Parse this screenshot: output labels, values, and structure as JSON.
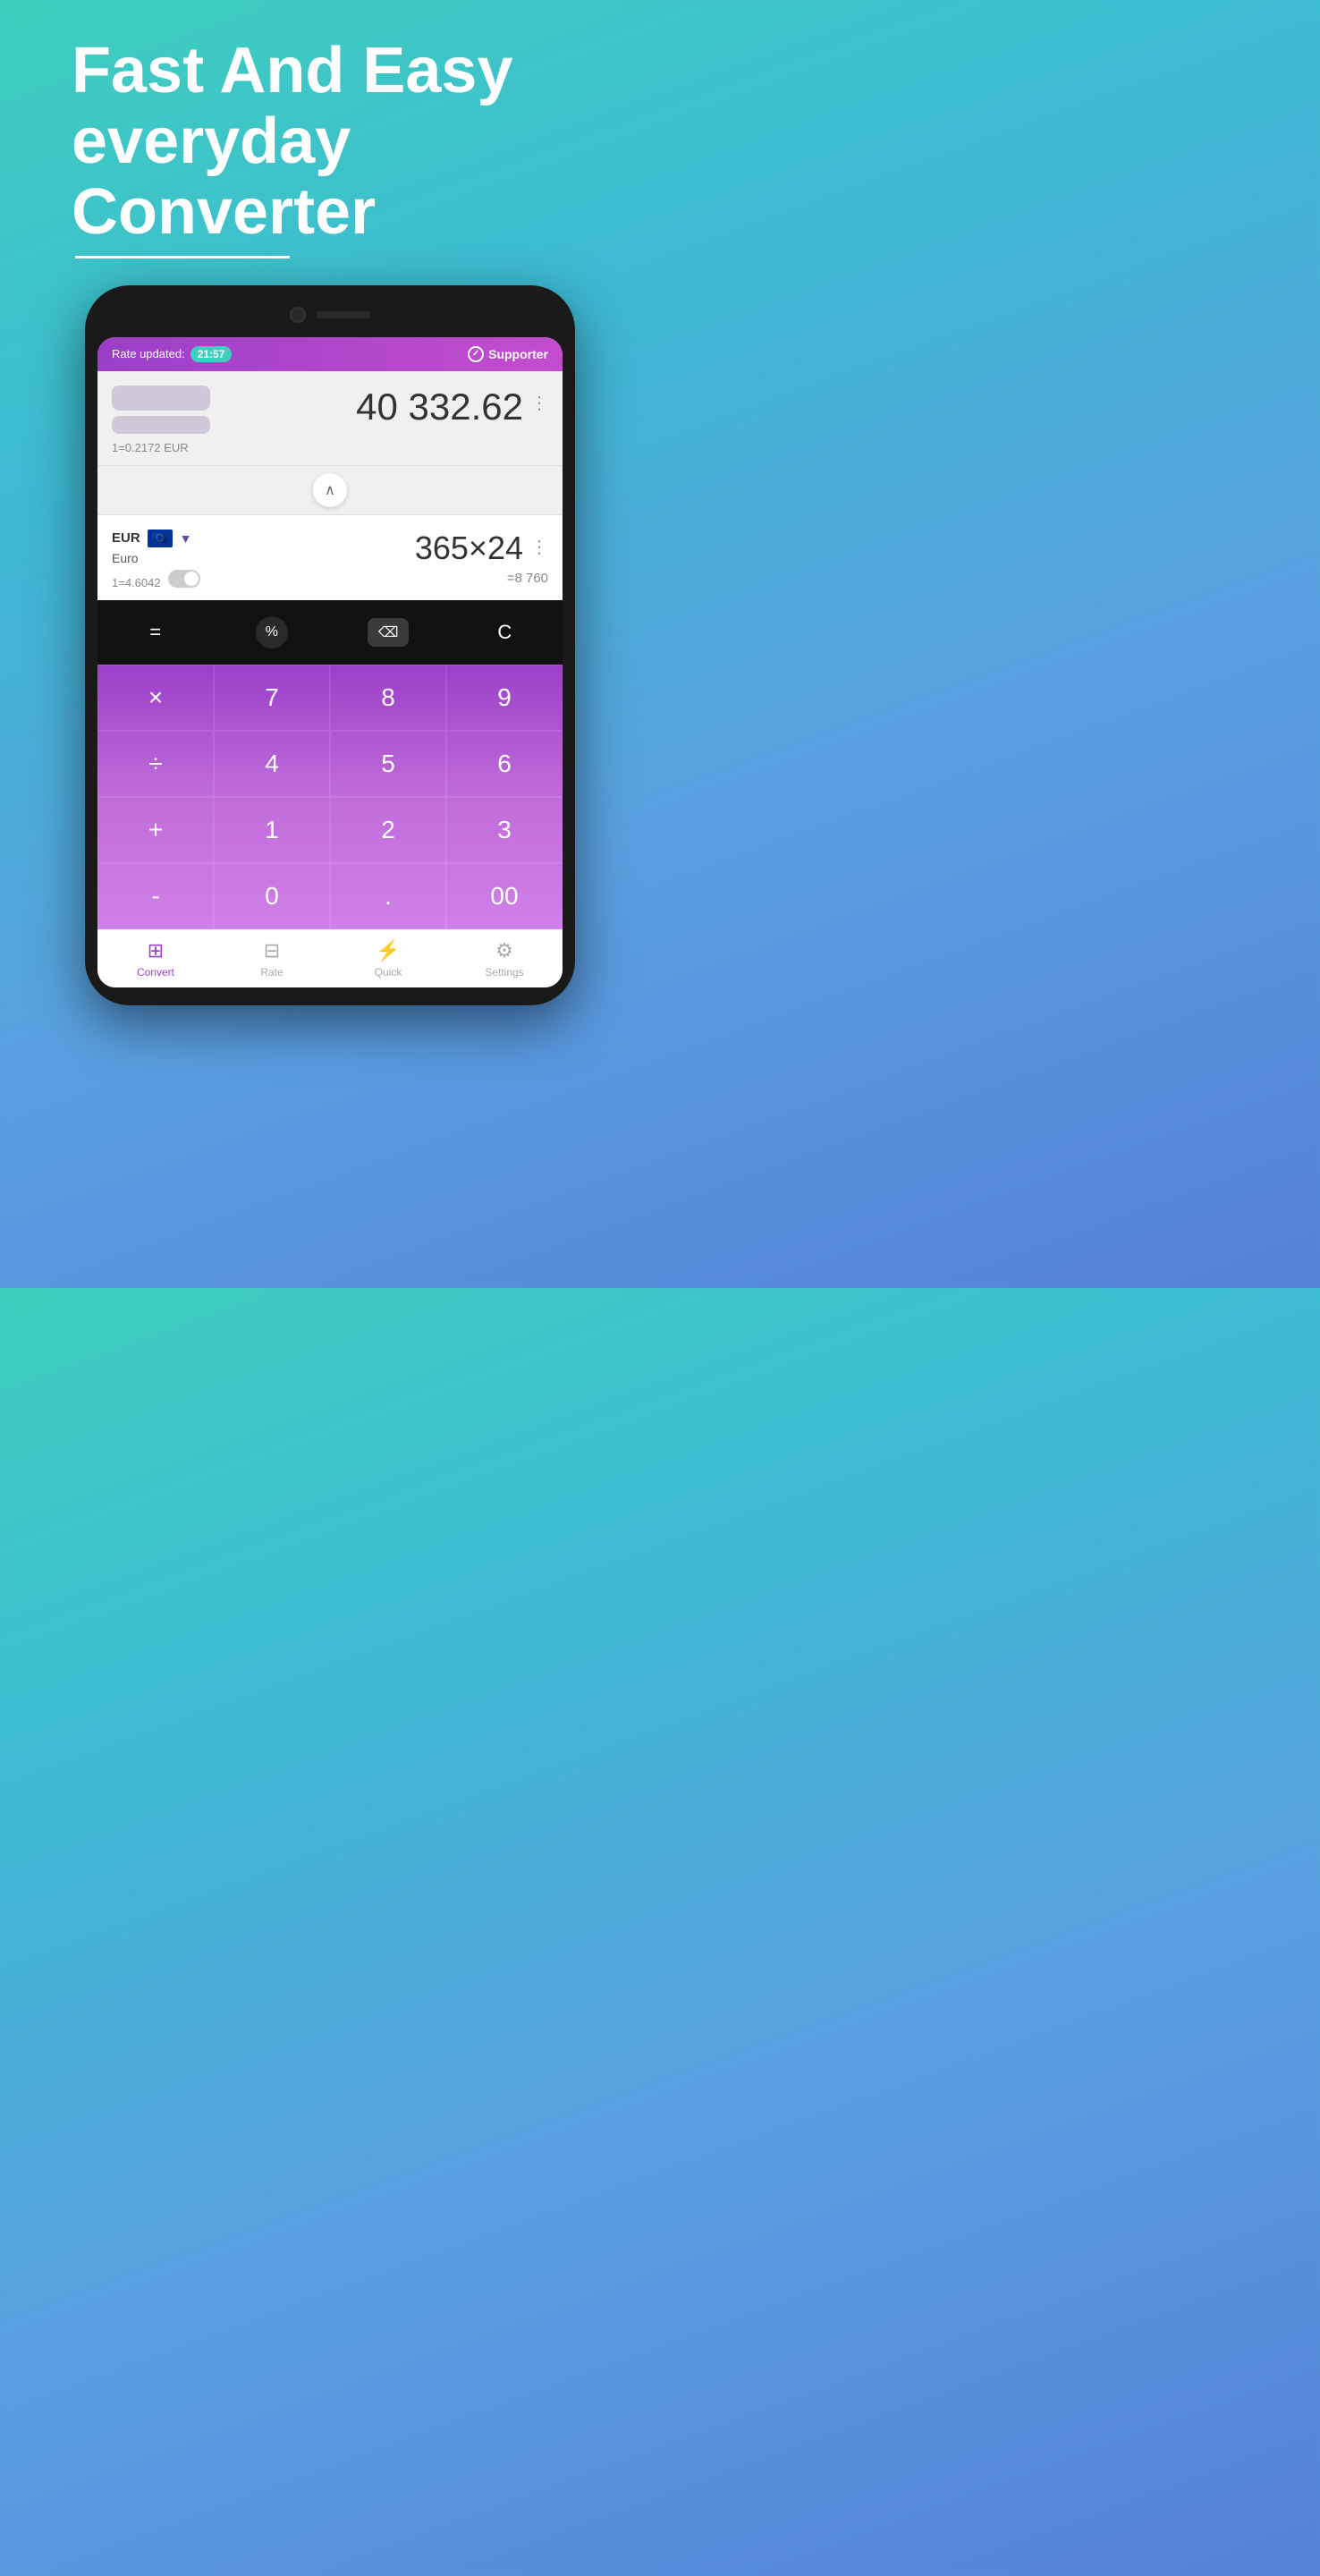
{
  "hero": {
    "title_line1": "Fast And Easy",
    "title_line2": "everyday",
    "title_line3": "Converter"
  },
  "app": {
    "header": {
      "rate_label": "Rate updated:",
      "time_value": "21:57",
      "supporter_label": "Supporter"
    },
    "row1": {
      "exchange_rate": "1=0.2172 EUR",
      "value": "40 332.62"
    },
    "row2": {
      "currency_code": "EUR",
      "currency_name": "Euro",
      "exchange_rate_prefix": "1=4.6042",
      "value": "365×24",
      "sub_result": "=8 760"
    },
    "keypad": {
      "equals": "=",
      "percent": "%",
      "backspace": "⌫",
      "clear": "C",
      "multiply": "×",
      "n7": "7",
      "n8": "8",
      "n9": "9",
      "divide": "÷",
      "n4": "4",
      "n5": "5",
      "n6": "6",
      "plus": "+",
      "n1": "1",
      "n2": "2",
      "n3": "3",
      "minus": "-",
      "n0": "0",
      "dot": ".",
      "double_zero": "00"
    },
    "nav": {
      "convert_label": "Convert",
      "rate_label": "Rate",
      "quick_label": "Quick",
      "settings_label": "Settings"
    }
  }
}
